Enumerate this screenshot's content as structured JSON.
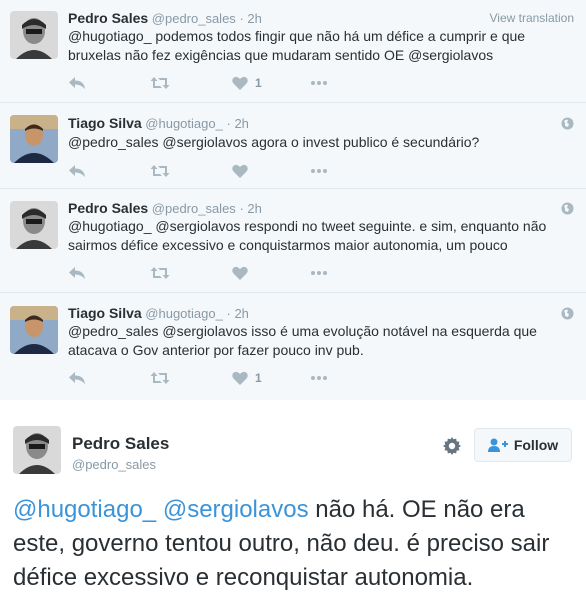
{
  "view_translation": "View translation",
  "tweets": [
    {
      "name": "Pedro Sales",
      "handle": "@pedro_sales",
      "time": "2h",
      "text": "@hugotiago_ podemos todos fingir que não há um défice a cumprir e que bruxelas não fez exigências que mudaram sentido OE @sergiolavos",
      "likes": "1"
    },
    {
      "name": "Tiago Silva",
      "handle": "@hugotiago_",
      "time": "2h",
      "text": "@pedro_sales @sergiolavos agora o invest publico é secundário?",
      "likes": ""
    },
    {
      "name": "Pedro Sales",
      "handle": "@pedro_sales",
      "time": "2h",
      "text": "@hugotiago_ @sergiolavos respondi no tweet seguinte. e sim, enquanto não sairmos défice excessivo e conquistarmos maior autonomia, um pouco",
      "likes": ""
    },
    {
      "name": "Tiago Silva",
      "handle": "@hugotiago_",
      "time": "2h",
      "text": "@pedro_sales @sergiolavos isso é uma evolução notável na esquerda que atacava o Gov anterior por fazer pouco inv pub.",
      "likes": "1"
    }
  ],
  "main": {
    "name": "Pedro Sales",
    "handle": "@pedro_sales",
    "follow_label": "Follow",
    "mention1": "@hugotiago_",
    "mention2": "@sergiolavos",
    "text_rest": " não há. OE não era este, governo tentou outro, não deu. é preciso sair défice excessivo e reconquistar autonomia."
  },
  "colors": {
    "link": "#3b94d9",
    "action_icon": "#aab8c2",
    "secondary_text": "#8899a6"
  }
}
